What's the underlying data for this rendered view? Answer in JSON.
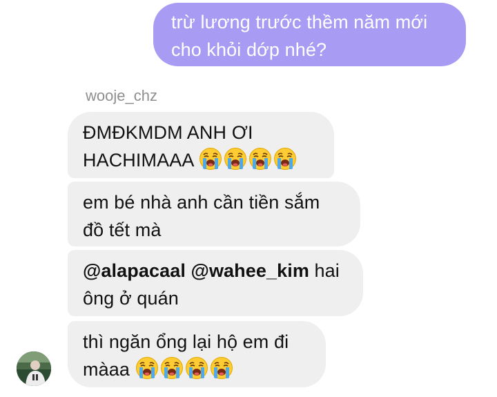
{
  "outgoing_message": {
    "line1": "trừ lương trước thềm năm mới",
    "line2": "cho khỏi dớp nhé?"
  },
  "sender_name": "wooje_chz",
  "messages": [
    {
      "line1": "ĐMĐKMDM ANH ƠI",
      "line2": "HACHIMAAA",
      "emoji": "loudly-crying-face-icon",
      "emoji_count": 4
    },
    {
      "line1": "em bé nhà anh cần tiền sắm",
      "line2": "đồ tết mà"
    },
    {
      "mention1": "@alapacaal",
      "mention2": "@wahee_kim",
      "line1_rest": " hai",
      "line2": "ông ở quán"
    },
    {
      "line1": "thì ngăn ổng lại hộ em đi",
      "line2": "màaa",
      "emoji": "loudly-crying-face-icon",
      "emoji_count": 4
    }
  ],
  "colors": {
    "outgoing_bubble": "#a89bf3",
    "incoming_bubble": "#efefef",
    "sender_name": "#8e8e8e"
  }
}
